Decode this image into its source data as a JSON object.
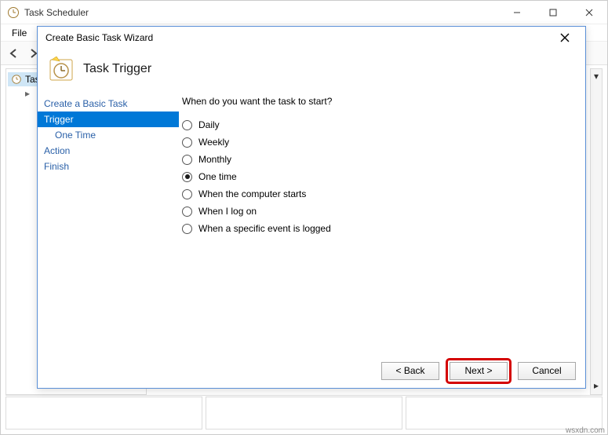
{
  "parent": {
    "title": "Task Scheduler",
    "menu": {
      "file": "File"
    },
    "tree": {
      "root": "Tas"
    }
  },
  "wizard": {
    "title": "Create Basic Task Wizard",
    "header": "Task Trigger",
    "steps": {
      "create": "Create a Basic Task",
      "trigger": "Trigger",
      "one_time": "One Time",
      "action": "Action",
      "finish": "Finish"
    },
    "question": "When do you want the task to start?",
    "options": {
      "daily": {
        "label": "Daily",
        "checked": false
      },
      "weekly": {
        "label": "Weekly",
        "checked": false
      },
      "monthly": {
        "label": "Monthly",
        "checked": false
      },
      "once": {
        "label": "One time",
        "checked": true
      },
      "startup": {
        "label": "When the computer starts",
        "checked": false
      },
      "logon": {
        "label": "When I log on",
        "checked": false
      },
      "event": {
        "label": "When a specific event is logged",
        "checked": false
      }
    },
    "buttons": {
      "back": "< Back",
      "next": "Next >",
      "cancel": "Cancel"
    }
  },
  "attribution": "wsxdn.com"
}
